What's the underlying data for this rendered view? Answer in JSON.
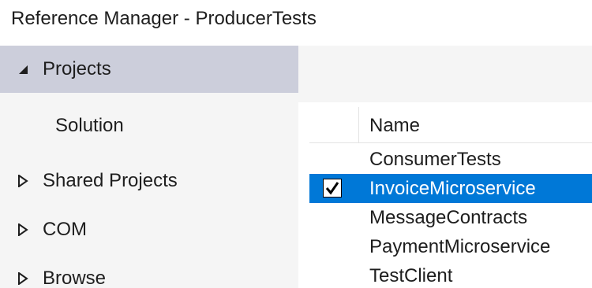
{
  "window": {
    "title": "Reference Manager - ProducerTests"
  },
  "sidebar": {
    "items": [
      {
        "label": "Projects",
        "expanded": true,
        "selected": true
      },
      {
        "label": "Solution",
        "child": true
      },
      {
        "label": "Shared Projects",
        "expanded": false
      },
      {
        "label": "COM",
        "expanded": false
      },
      {
        "label": "Browse",
        "expanded": false
      }
    ]
  },
  "grid": {
    "header": {
      "name_label": "Name"
    },
    "rows": [
      {
        "name": "ConsumerTests",
        "checked": false,
        "selected": false
      },
      {
        "name": "InvoiceMicroservice",
        "checked": true,
        "selected": true
      },
      {
        "name": "MessageContracts",
        "checked": false,
        "selected": false
      },
      {
        "name": "PaymentMicroservice",
        "checked": false,
        "selected": false
      },
      {
        "name": "TestClient",
        "checked": false,
        "selected": false
      }
    ]
  },
  "colors": {
    "selection": "#0078d7",
    "nav_selected": "#cccedb",
    "pane": "#f5f5f5"
  }
}
